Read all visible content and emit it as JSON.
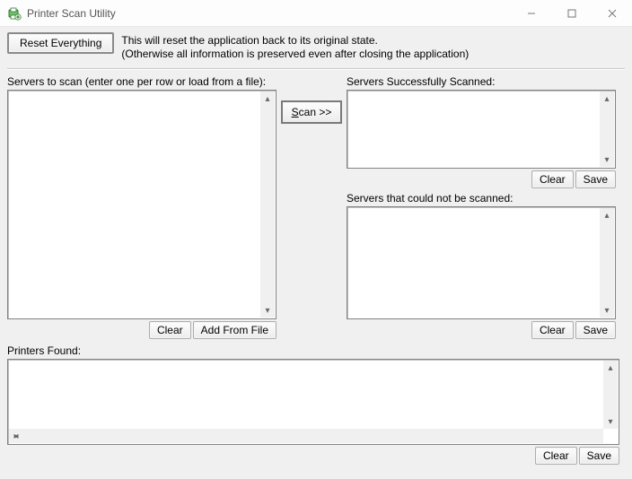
{
  "window": {
    "title": "Printer Scan Utility"
  },
  "reset": {
    "button": "Reset Everything",
    "help_line1": "This will reset the application back to its original state.",
    "help_line2": "(Otherwise all information is preserved even after closing the application)"
  },
  "labels": {
    "servers_to_scan": "Servers to scan (enter one per row or load from a file):",
    "servers_success": "Servers Successfully Scanned:",
    "servers_fail": "Servers that could not be scanned:",
    "printers_found": "Printers Found:"
  },
  "buttons": {
    "clear": "Clear",
    "add_from_file": "Add From File",
    "save": "Save",
    "scan_prefix": "S",
    "scan_rest": "can >>"
  }
}
